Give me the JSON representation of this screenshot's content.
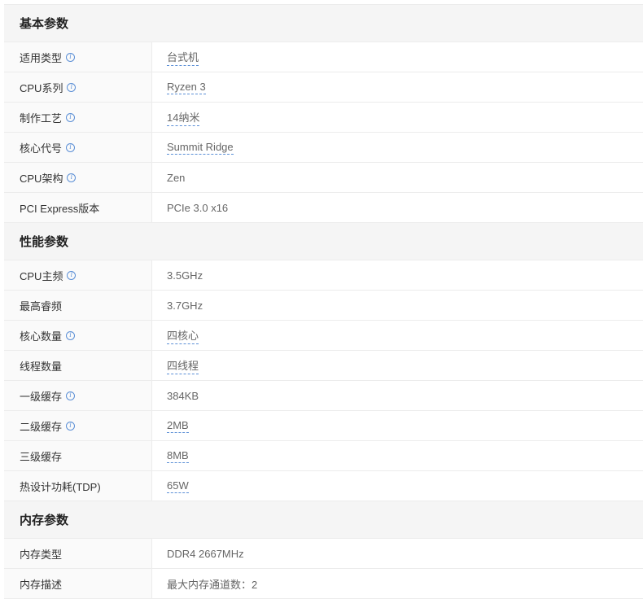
{
  "sections": [
    {
      "title": "基本参数",
      "rows": [
        {
          "label": "适用类型",
          "value": "台式机",
          "info": true,
          "link": true
        },
        {
          "label": "CPU系列",
          "value": "Ryzen 3",
          "info": true,
          "link": true
        },
        {
          "label": "制作工艺",
          "value": "14纳米",
          "info": true,
          "link": true
        },
        {
          "label": "核心代号",
          "value": "Summit Ridge",
          "info": true,
          "link": true
        },
        {
          "label": "CPU架构",
          "value": "Zen",
          "info": true,
          "link": false
        },
        {
          "label": "PCI Express版本",
          "value": "PCIe 3.0 x16",
          "info": false,
          "link": false
        }
      ]
    },
    {
      "title": "性能参数",
      "rows": [
        {
          "label": "CPU主频",
          "value": "3.5GHz",
          "info": true,
          "link": false
        },
        {
          "label": "最高睿频",
          "value": "3.7GHz",
          "info": false,
          "link": false
        },
        {
          "label": "核心数量",
          "value": "四核心",
          "info": true,
          "link": true
        },
        {
          "label": "线程数量",
          "value": "四线程",
          "info": false,
          "link": true
        },
        {
          "label": "一级缓存",
          "value": "384KB",
          "info": true,
          "link": false
        },
        {
          "label": "二级缓存",
          "value": "2MB",
          "info": true,
          "link": true
        },
        {
          "label": "三级缓存",
          "value": "8MB",
          "info": false,
          "link": true
        },
        {
          "label": "热设计功耗(TDP)",
          "value": "65W",
          "info": false,
          "link": true
        }
      ]
    },
    {
      "title": "内存参数",
      "rows": [
        {
          "label": "内存类型",
          "value": "DDR4 2667MHz",
          "info": false,
          "link": false
        },
        {
          "label": "内存描述",
          "value": "最大内存通道数：2",
          "info": false,
          "link": false
        }
      ]
    }
  ],
  "icons": {
    "info": "ⓘ"
  },
  "colors": {
    "accent": "#5b8fd6",
    "header_bg": "#f5f5f5",
    "label_bg": "#fafafa",
    "border": "#ececec"
  }
}
